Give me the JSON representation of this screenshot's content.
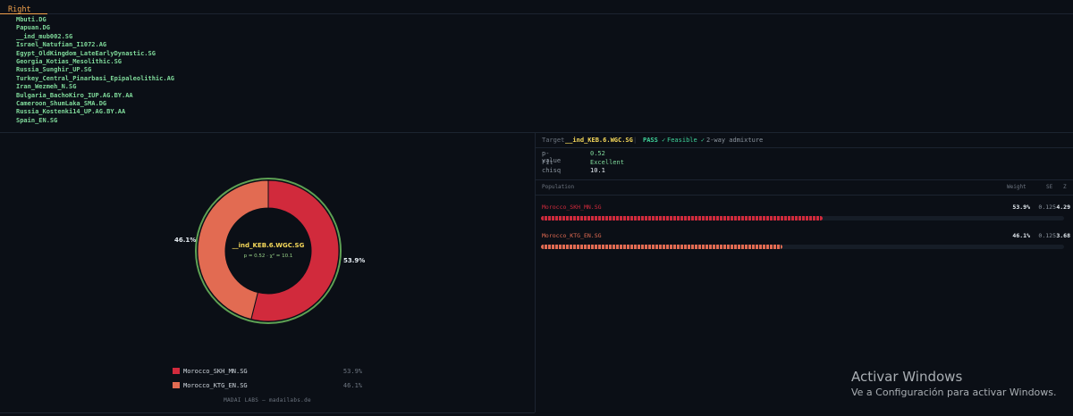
{
  "top": {
    "tab_label": "Right",
    "populations": [
      "Mbuti.DG",
      "Papuan.DG",
      "__ind_mub002.SG",
      "Israel_Natufian_I1072.AG",
      "Egypt_OldKingdom_LateEarlyDynastic.SG",
      "Georgia_Kotias_Mesolithic.SG",
      "Russia_Sunghir_UP.SG",
      "Turkey_Central_Pinarbasi_Epipaleolithic.AG",
      "Iran_Wezmeh_N.SG",
      "Bulgaria_BachoKiro_IUP.AG.BY.AA",
      "Cameroon_ShumLaka_SMA.DG",
      "Russia_Kostenki14_UP.AG.BY.AA",
      "Spain_EN.SG"
    ]
  },
  "chart_data": {
    "type": "pie",
    "variant": "donut",
    "center_title": "__ind_KEB.6.WGC.SG",
    "center_stats": "p = 0.52 · χ² = 10.1",
    "slices": [
      {
        "name": "Morocco_SKH_MN.SG",
        "value": 53.9,
        "label": "53.9%",
        "color": "#d12a3c"
      },
      {
        "name": "Morocco_KTG_EN.SG",
        "value": 46.1,
        "label": "46.1%",
        "color": "#e26b52"
      }
    ]
  },
  "legend": [
    {
      "name": "Morocco_SKH_MN.SG",
      "pct": "53.9%",
      "color": "#d12a3c"
    },
    {
      "name": "Morocco_KTG_EN.SG",
      "pct": "46.1%",
      "color": "#e26b52"
    }
  ],
  "footer": "MADAI LABS — madailabs.de",
  "header": {
    "target_label": "Target",
    "target_value": "__ind_KEB.6.WGC.SG",
    "separator": "|",
    "pass": "PASS ✓",
    "feasible": "Feasible ✓",
    "admixture": "2-way admixture"
  },
  "stats": [
    {
      "label": "p-value",
      "value": "0.52"
    },
    {
      "label": "Fit",
      "value": "Excellent"
    },
    {
      "label": "chisq",
      "value": "10.1"
    }
  ],
  "table": {
    "headers": {
      "population": "Population",
      "weight": "Weight",
      "se": "SE",
      "z": "Z"
    },
    "rows": [
      {
        "name": "Morocco_SKH_MN.SG",
        "weight": "53.9%",
        "fraction": 0.539,
        "se": "0.125",
        "z": "4.29",
        "color": "#d12a3c"
      },
      {
        "name": "Morocco_KTG_EN.SG",
        "weight": "46.1%",
        "fraction": 0.461,
        "se": "0.125",
        "z": "3.68",
        "color": "#e26b52"
      }
    ]
  },
  "watermark": {
    "title": "Activar Windows",
    "subtitle": "Ve a Configuración para activar Windows."
  }
}
